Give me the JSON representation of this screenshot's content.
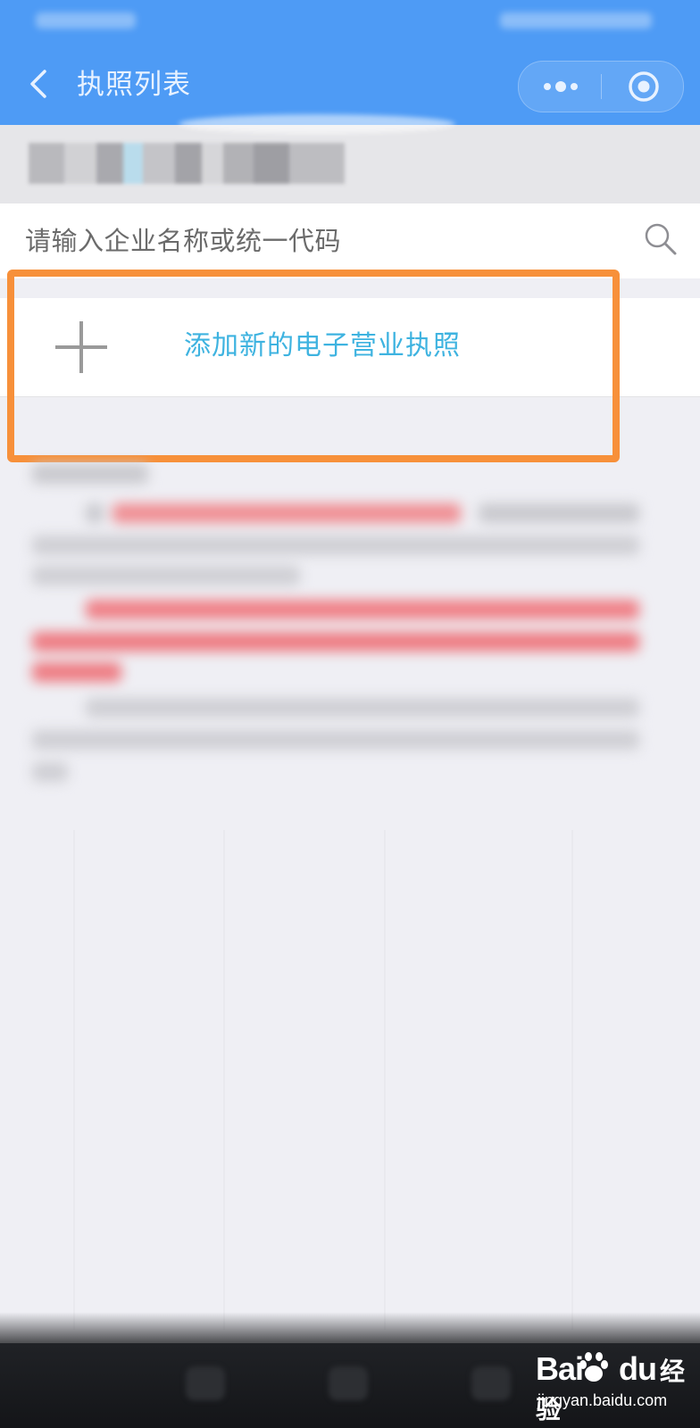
{
  "nav": {
    "title": "执照列表"
  },
  "search": {
    "placeholder": "请输入企业名称或统一代码"
  },
  "add_license": {
    "label": "添加新的电子营业执照"
  },
  "watermark": {
    "logo_left": "Bai",
    "logo_right": "du",
    "logo_cn": "经验",
    "url": "jingyan.baidu.com"
  },
  "colors": {
    "nav_bg": "#4e9bf5",
    "accent_text": "#3eb3e0",
    "highlight": "#f7903a",
    "page_bg": "#efeff4"
  }
}
